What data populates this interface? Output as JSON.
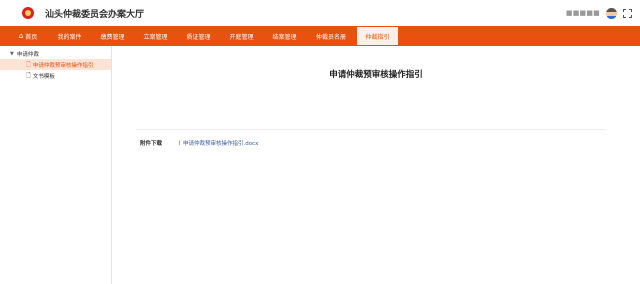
{
  "header": {
    "title": "汕头仲裁委员会办案大厅",
    "user_name": "■■■■■"
  },
  "nav": {
    "items": [
      {
        "label": "首页",
        "icon": "home-icon"
      },
      {
        "label": "我的案件"
      },
      {
        "label": "缴费管理"
      },
      {
        "label": "立案管理"
      },
      {
        "label": "质证管理"
      },
      {
        "label": "开庭管理"
      },
      {
        "label": "结案管理"
      },
      {
        "label": "仲裁员名册"
      },
      {
        "label": "仲裁指引"
      }
    ],
    "active_index": 8
  },
  "sidebar": {
    "group_label": "申请仲裁",
    "items": [
      {
        "label": "申请仲裁预审核操作指引",
        "selected": true,
        "icon": "document-icon"
      },
      {
        "label": "文书模板",
        "selected": false,
        "icon": "document-icon"
      }
    ]
  },
  "content": {
    "title": "申请仲裁预审核操作指引",
    "attachment_label": "附件下载",
    "attachment_file": "申请仲裁预审核操作指引.docx"
  },
  "colors": {
    "accent": "#e8520f",
    "selected_bg": "#fbe3d5",
    "link": "#3b5ba8"
  }
}
